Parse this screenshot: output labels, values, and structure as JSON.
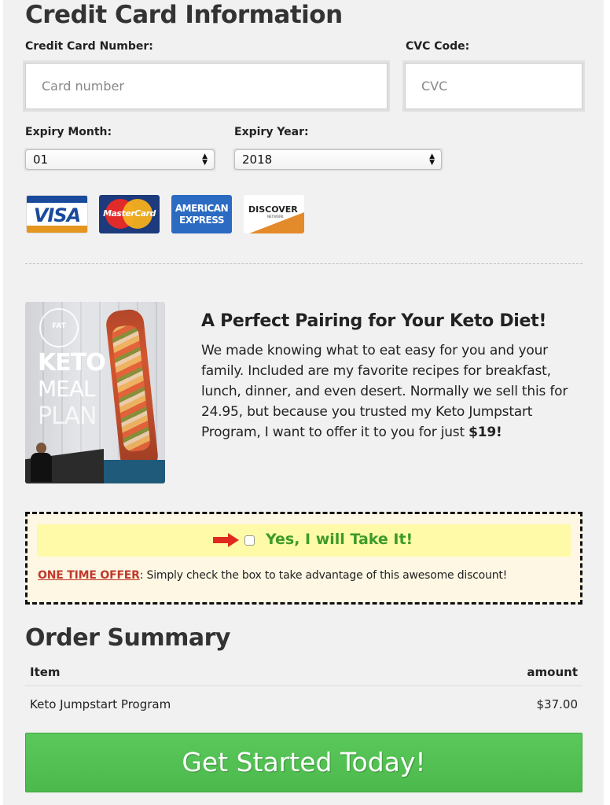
{
  "card_section": {
    "title": "Credit Card Information",
    "card_number_label": "Credit Card Number:",
    "card_number_placeholder": "Card number",
    "cvc_label": "CVC Code:",
    "cvc_placeholder": "CVC",
    "expiry_month_label": "Expiry Month:",
    "expiry_month_value": "01",
    "expiry_year_label": "Expiry Year:",
    "expiry_year_value": "2018",
    "card_logos": {
      "visa": "VISA",
      "mastercard": "MasterCard",
      "amex_line1": "AMERICAN",
      "amex_line2": "EXPRESS",
      "discover": "DISCOVER",
      "discover_sub": "NETWORK"
    }
  },
  "upsell": {
    "book_cover": {
      "logo_text": "FAT",
      "line1": "KETO",
      "line2": "MEAL",
      "line3": "PLAN"
    },
    "title": "A Perfect Pairing for Your Keto Diet!",
    "description": "We made knowing what to eat easy for you and your family. Included are my favorite recipes for breakfast, lunch, dinner, and even desert. Normally we sell this for 24.95, but because you trusted my Keto Jumpstart Program, I want to offer it to you for just ",
    "price": "$19!"
  },
  "offer_box": {
    "accept_label": "Yes, I will Take It!",
    "one_time_label": "ONE TIME OFFER",
    "note": ": Simply check the box to take advantage of this awesome discount!"
  },
  "order_summary": {
    "title": "Order Summary",
    "col_item": "Item",
    "col_amount": "amount",
    "rows": [
      {
        "item": "Keto Jumpstart Program",
        "amount": "$37.00"
      }
    ]
  },
  "cta": {
    "label": "Get Started Today!"
  },
  "colors": {
    "accent_green": "#4cb94c",
    "offer_yellow": "#fefaa8",
    "offer_red": "#c0392b",
    "yes_green": "#3d9b28"
  }
}
